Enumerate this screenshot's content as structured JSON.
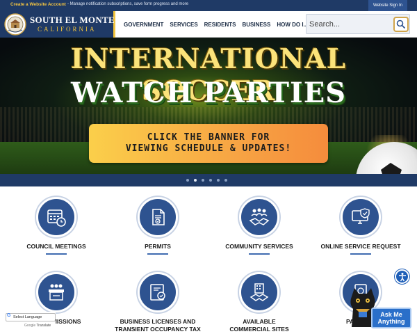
{
  "topbar": {
    "create_link": "Create a Website Account",
    "create_desc": "- Manage notification subscriptions, save form progress and more",
    "signin": "Website Sign In"
  },
  "logo": {
    "title": "SOUTH EL MONTE",
    "subtitle": "CALIFORNIA",
    "seal_icon": "city-seal-icon"
  },
  "nav": {
    "items": [
      {
        "label": "GOVERNMENT"
      },
      {
        "label": "SERVICES"
      },
      {
        "label": "RESIDENTS"
      },
      {
        "label": "BUSINESS"
      },
      {
        "label": "HOW DO I..."
      }
    ]
  },
  "search": {
    "placeholder": "Search...",
    "icon": "search-icon"
  },
  "banner": {
    "title_line1": "INTERNATIONAL SOCCER",
    "title_line2": "WATCH PARTIES",
    "cta_line1": "CLICK THE BANNER FOR",
    "cta_line2": "VIEWING SCHEDULE & UPDATES!",
    "active_slide": 2,
    "slide_count": 6
  },
  "tiles": [
    {
      "label": "COUNCIL MEETINGS",
      "icon": "calendar-clock-icon"
    },
    {
      "label": "PERMITS",
      "icon": "document-check-icon"
    },
    {
      "label": "COMMUNITY SERVICES",
      "icon": "handshake-people-icon"
    },
    {
      "label": "ONLINE SERVICE REQUEST",
      "icon": "computer-check-icon"
    },
    {
      "label": "... COMMISSIONS",
      "icon": "meeting-podium-icon"
    },
    {
      "label": "BUSINESS LICENSES AND",
      "label2": "TRANSIENT OCCUPANCY TAX",
      "icon": "license-certificate-icon"
    },
    {
      "label": "AVAILABLE",
      "label2": "COMMERCIAL SITES",
      "icon": "building-handshake-icon"
    },
    {
      "label": "PASSPO...",
      "icon": "passport-icon"
    }
  ],
  "translate": {
    "select_label": "Select Language",
    "powered_by": "Google",
    "translate_word": "Translate"
  },
  "ask": {
    "line1": "Ask Me",
    "line2": "Anything"
  },
  "colors": {
    "navy": "#1f3a66",
    "tile_blue": "#2e5390",
    "gold": "#f2c43d",
    "cta_orange": "#f7a544"
  }
}
